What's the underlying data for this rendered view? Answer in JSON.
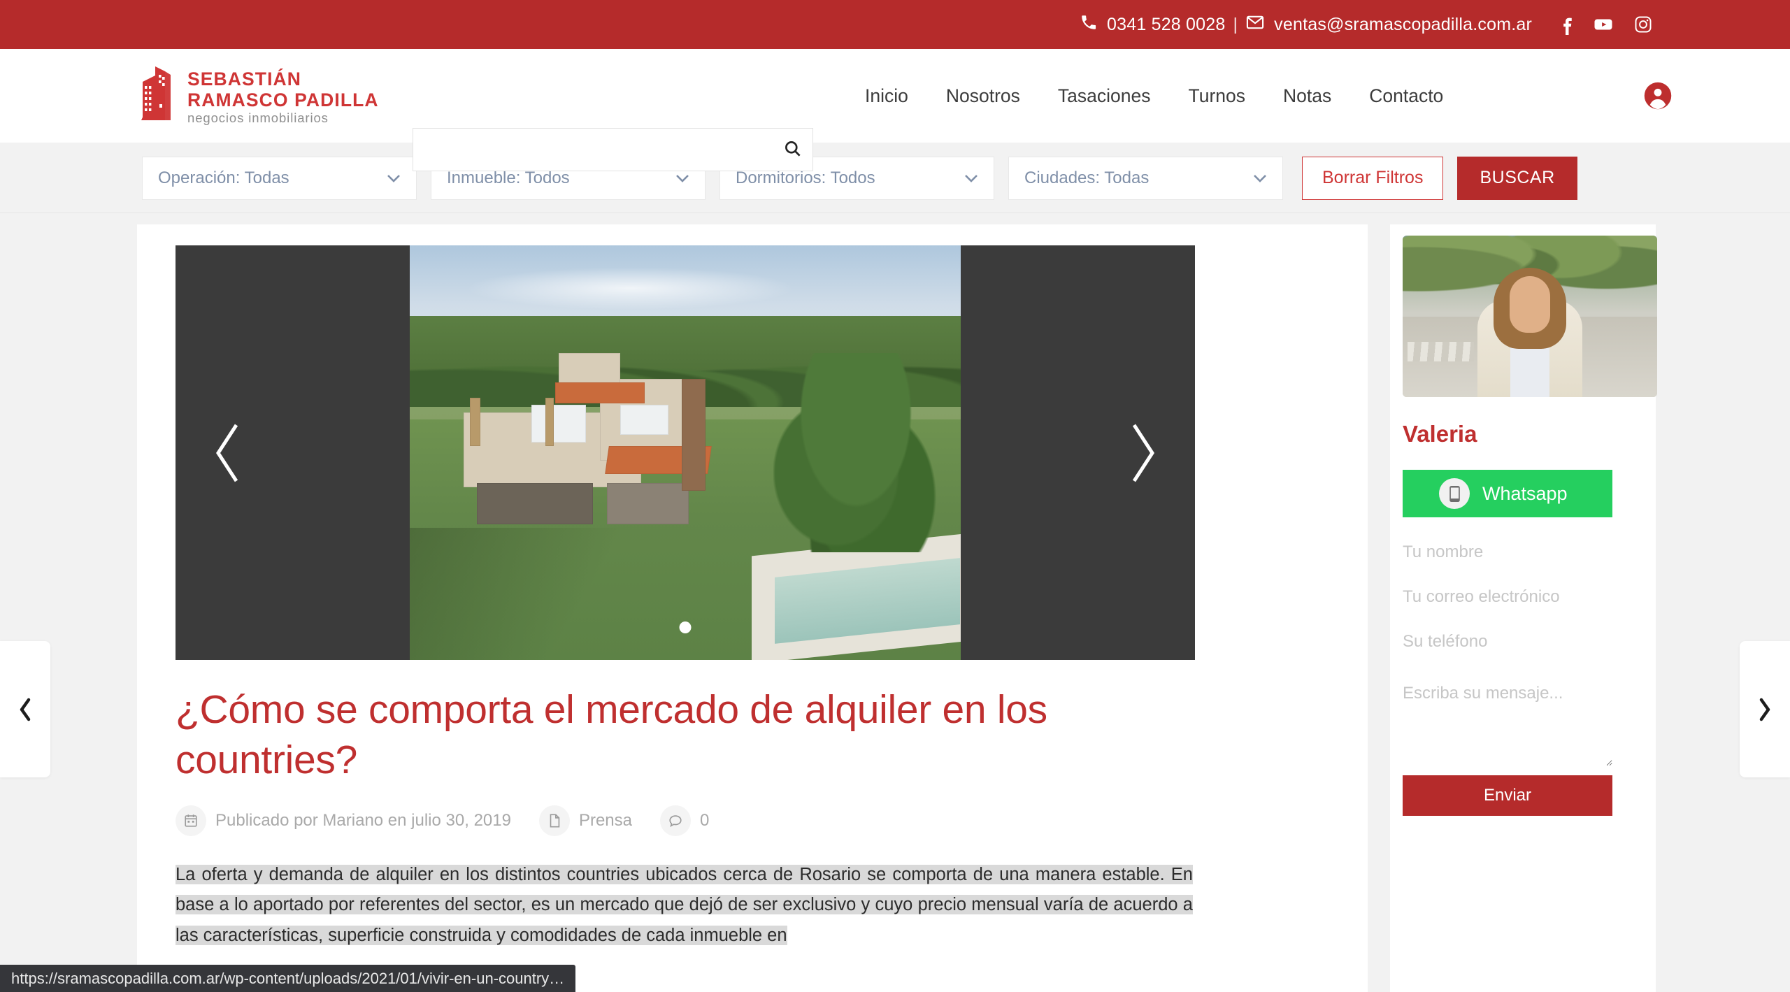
{
  "colors": {
    "brand_red_dark": "#b52b2b",
    "brand_red": "#cf3535",
    "title_red": "#bf2f2f",
    "whatsapp_green": "#25cf5f",
    "filter_text": "#7f8fa8",
    "carousel_bg": "#3b3b3b",
    "meta_gray": "#a9a9a9",
    "selection_gray": "#d9d9d9"
  },
  "topbar": {
    "phone": "0341 528 0028",
    "separator": "|",
    "email": "ventas@sramascopadilla.com.ar",
    "icons": {
      "phone": "phone-icon",
      "mail": "envelope-icon",
      "facebook": "facebook-icon",
      "youtube": "youtube-icon",
      "instagram": "instagram-icon"
    }
  },
  "header": {
    "logo": {
      "line1": "SEBASTIÁN",
      "line2": "RAMASCO PADILLA",
      "line3": "negocios inmobiliarios",
      "mark": "building-icon"
    },
    "search": {
      "value": "",
      "placeholder": "",
      "icon": "search-icon"
    },
    "nav": [
      {
        "label": "Inicio"
      },
      {
        "label": "Nosotros"
      },
      {
        "label": "Tasaciones"
      },
      {
        "label": "Turnos"
      },
      {
        "label": "Notas"
      },
      {
        "label": "Contacto"
      }
    ],
    "account_icon": "user-circle-icon"
  },
  "filterbar": {
    "selects": [
      {
        "label": "Operación: Todas",
        "icon": "chevron-down-icon"
      },
      {
        "label": "Inmueble: Todos",
        "icon": "chevron-down-icon"
      },
      {
        "label": "Dormitorios: Todos",
        "icon": "chevron-down-icon"
      },
      {
        "label": "Ciudades: Todas",
        "icon": "chevron-down-icon"
      }
    ],
    "clear_label": "Borrar Filtros",
    "search_label": "BUSCAR"
  },
  "carousel": {
    "prev_icon": "chevron-left-icon",
    "next_icon": "chevron-right-icon",
    "slide_count": 1,
    "active_slide": 1,
    "image_alt": "vivir-en-un-country"
  },
  "article": {
    "title": "¿Cómo se comporta el mercado de alquiler en los countries?",
    "meta": {
      "date_icon": "calendar-icon",
      "date_text": "Publicado por Mariano en julio 30, 2019",
      "category_icon": "file-icon",
      "category_text": "Prensa",
      "comments_icon": "comment-icon",
      "comments_count": "0"
    },
    "body": "La oferta y demanda de alquiler en los distintos countries ubicados cerca de Rosario se comporta de una manera estable. En base a lo aportado por referentes del sector, es un mercado que dejó de ser exclusivo y cuyo precio mensual varía de acuerdo a las características, superficie construida y comodidades de cada inmueble en"
  },
  "sidebar": {
    "agent": {
      "photo_alt": "agent-photo",
      "name": "Valeria"
    },
    "whatsapp": {
      "label": "Whatsapp",
      "icon": "mobile-phone-icon"
    },
    "form": {
      "name_placeholder": "Tu nombre",
      "name_value": "",
      "email_placeholder": "Tu correo electrónico",
      "email_value": "",
      "phone_placeholder": "Su teléfono",
      "phone_value": "",
      "message_placeholder": "Escriba su mensaje...",
      "message_value": "",
      "send_label": "Enviar"
    }
  },
  "edge_nav": {
    "prev_icon": "chevron-left-icon",
    "next_icon": "chevron-right-icon"
  },
  "statusbar": {
    "url": "https://sramascopadilla.com.ar/wp-content/uploads/2021/01/vivir-en-un-country…"
  }
}
